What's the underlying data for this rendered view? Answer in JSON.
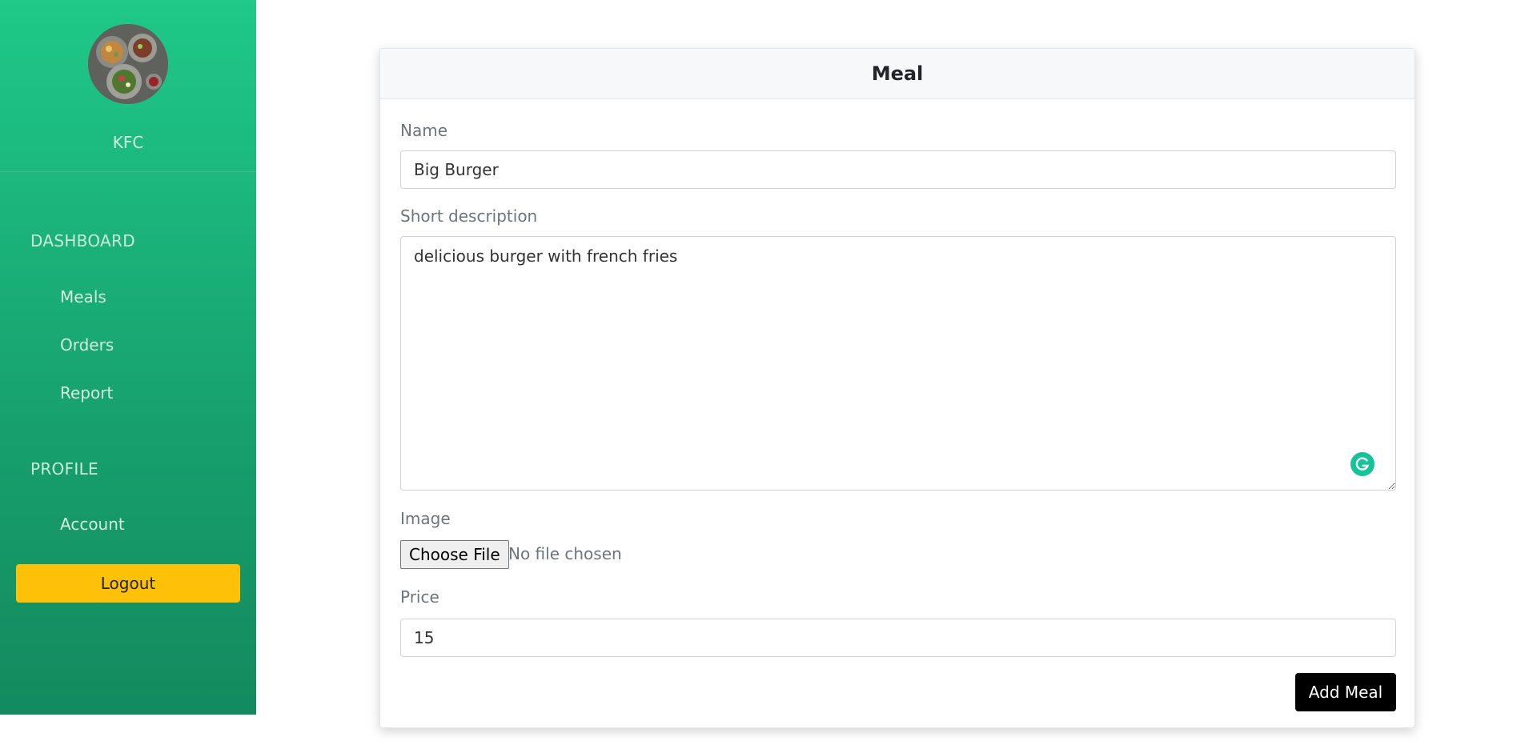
{
  "sidebar": {
    "restaurant_name": "KFC",
    "sections": [
      {
        "title": "DASHBOARD",
        "items": [
          {
            "label": "Meals"
          },
          {
            "label": "Orders"
          },
          {
            "label": "Report"
          }
        ]
      },
      {
        "title": "PROFILE",
        "items": [
          {
            "label": "Account"
          }
        ]
      }
    ],
    "logout_label": "Logout",
    "gradient_top": "#1fc988",
    "gradient_bottom": "#138a5f"
  },
  "form": {
    "title": "Meal",
    "name_label": "Name",
    "name_value": "Big Burger",
    "description_label": "Short description",
    "description_value": "delicious burger with french fries",
    "image_label": "Image",
    "file_button_label": "Choose File",
    "file_status": "No file chosen",
    "price_label": "Price",
    "price_value": "15",
    "submit_label": "Add Meal",
    "grammarly_icon": "grammarly-icon"
  },
  "colors": {
    "logout_bg": "#ffc107",
    "submit_bg": "#000000",
    "accent_green": "#15c39a"
  }
}
